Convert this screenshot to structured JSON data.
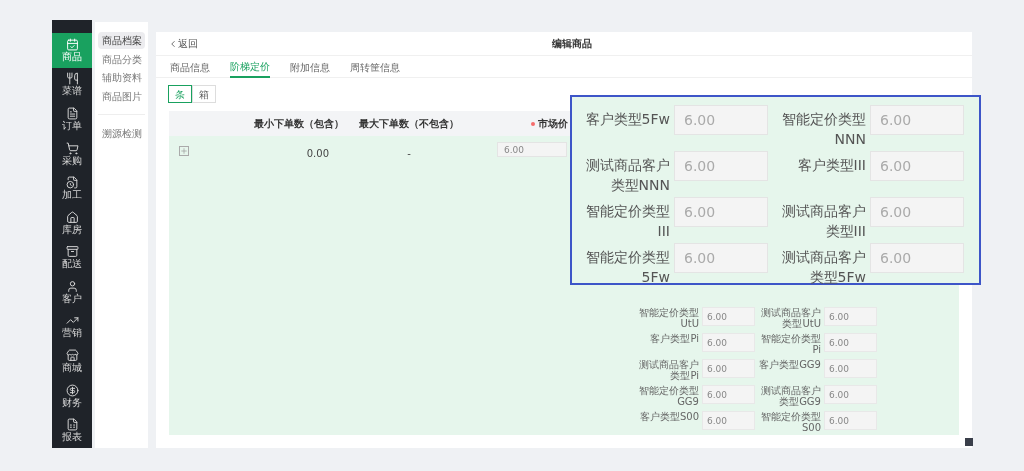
{
  "nav": [
    {
      "label": "商品",
      "selected": true
    },
    {
      "label": "菜谱",
      "selected": false
    },
    {
      "label": "订单",
      "selected": false
    },
    {
      "label": "采购",
      "selected": false
    },
    {
      "label": "加工",
      "selected": false
    },
    {
      "label": "库房",
      "selected": false
    },
    {
      "label": "配送",
      "selected": false
    },
    {
      "label": "客户",
      "selected": false
    },
    {
      "label": "营销",
      "selected": false
    },
    {
      "label": "商城",
      "selected": false
    },
    {
      "label": "财务",
      "selected": false
    },
    {
      "label": "报表",
      "selected": false
    }
  ],
  "subnav": [
    [
      {
        "label": "商品档案",
        "selected": true
      },
      {
        "label": "商品分类",
        "selected": false
      },
      {
        "label": "辅助资料",
        "selected": false
      },
      {
        "label": "商品图片",
        "selected": false
      }
    ],
    [
      {
        "label": "溯源检测",
        "selected": false
      }
    ]
  ],
  "back": "返回",
  "title": "编辑商品",
  "tabs": [
    {
      "label": "商品信息",
      "selected": false
    },
    {
      "label": "阶梯定价",
      "selected": true
    },
    {
      "label": "附加信息",
      "selected": false
    },
    {
      "label": "周转筐信息",
      "selected": false
    }
  ],
  "units": [
    {
      "label": "条",
      "selected": true
    },
    {
      "label": "箱",
      "selected": false
    }
  ],
  "table": {
    "columns": [
      {
        "label": "最小下单数（包含）",
        "required": false
      },
      {
        "label": "最大下单数（不包含）",
        "required": false
      },
      {
        "label": "市场价",
        "required": true
      }
    ],
    "rows": [
      {
        "min": "0.00",
        "max": "-",
        "market_price": "6.00",
        "customer_prices": [
          {
            "label": "智能定价类型UtU",
            "value": "6.00"
          },
          {
            "label": "测试商品客户类型UtU",
            "value": "6.00"
          },
          {
            "label": "客户类型Pi",
            "value": "6.00"
          },
          {
            "label": "智能定价类型Pi",
            "value": "6.00"
          },
          {
            "label": "测试商品客户类型Pi",
            "value": "6.00"
          },
          {
            "label": "客户类型GG9",
            "value": "6.00"
          },
          {
            "label": "智能定价类型GG9",
            "value": "6.00"
          },
          {
            "label": "测试商品客户类型GG9",
            "value": "6.00"
          },
          {
            "label": "客户类型S00",
            "value": "6.00"
          },
          {
            "label": "智能定价类型S00",
            "value": "6.00"
          }
        ]
      }
    ]
  },
  "callout": {
    "fields": [
      {
        "label": "客户类型5Fw",
        "value": "6.00"
      },
      {
        "label": "智能定价类型NNN",
        "value": "6.00"
      },
      {
        "label": "测试商品客户类型NNN",
        "value": "6.00"
      },
      {
        "label": "客户类型III",
        "value": "6.00"
      },
      {
        "label": "智能定价类型III",
        "value": "6.00"
      },
      {
        "label": "测试商品客户类型III",
        "value": "6.00"
      },
      {
        "label": "智能定价类型5Fw",
        "value": "6.00"
      },
      {
        "label": "测试商品客户类型5Fw",
        "value": "6.00"
      }
    ]
  }
}
